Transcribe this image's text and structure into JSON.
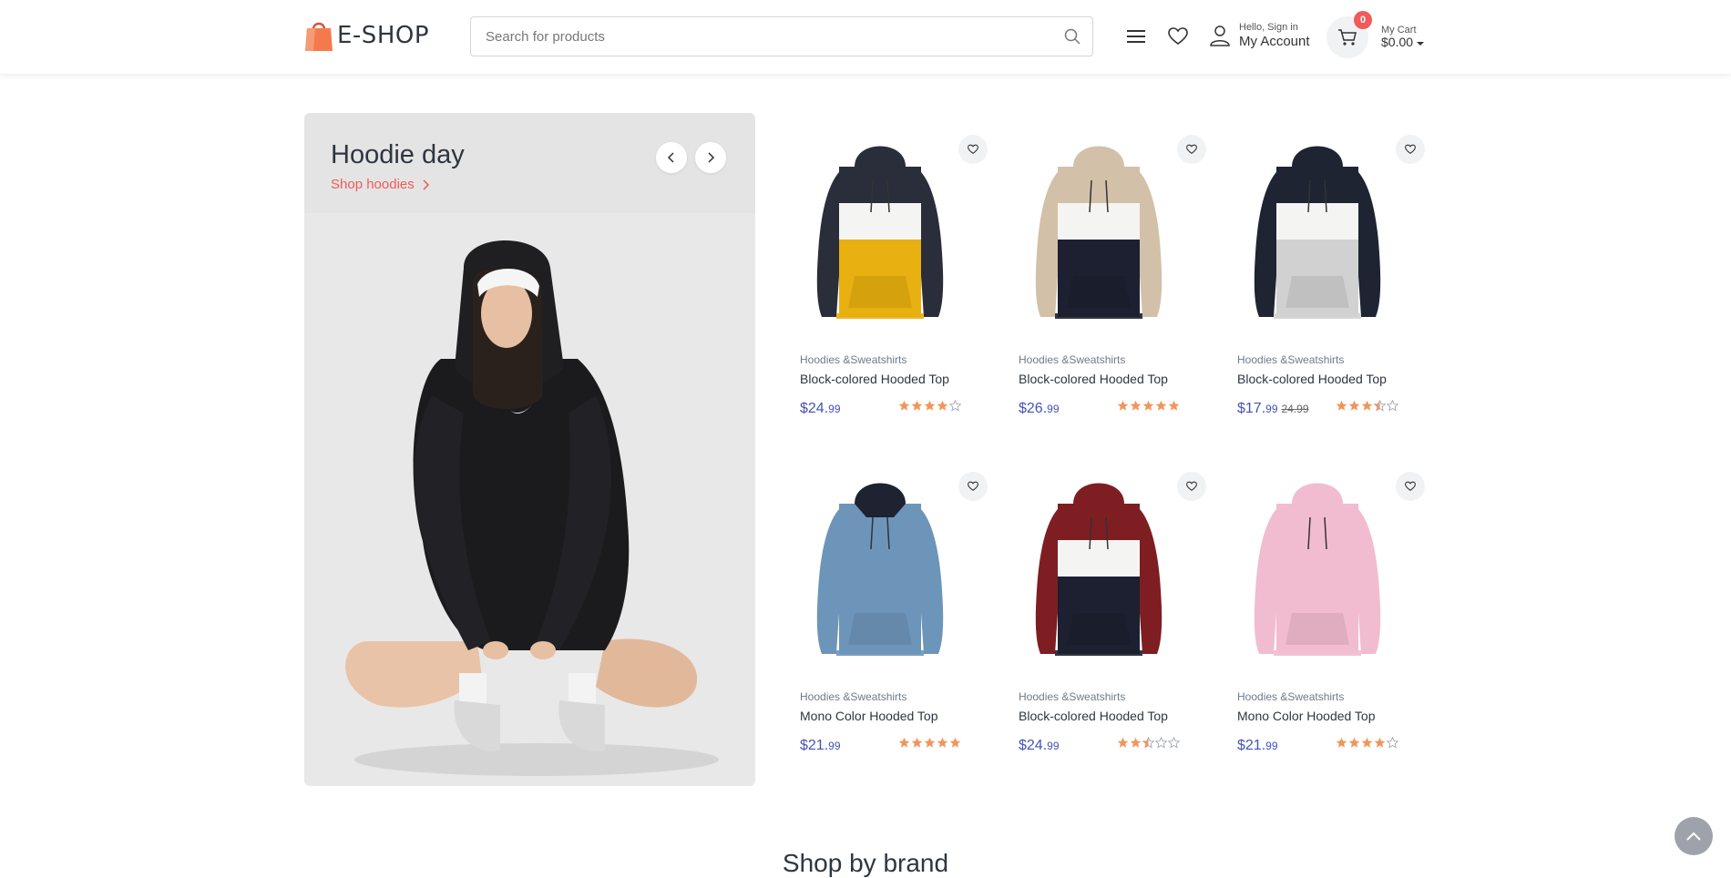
{
  "header": {
    "logo_text": "E-SHOP",
    "search_placeholder": "Search for products",
    "account_greeting": "Hello, Sign in",
    "account_label": "My Account",
    "cart_label": "My Cart",
    "cart_total": "$0.00",
    "cart_count": "0"
  },
  "banner": {
    "title": "Hoodie day",
    "link": "Shop hoodies"
  },
  "products": [
    {
      "category": "Hoodies &Sweatshirts",
      "name": "Block-colored Hooded Top",
      "price_main": "$24.",
      "price_cents": "99",
      "old_price": "",
      "rating": 4
    },
    {
      "category": "Hoodies &Sweatshirts",
      "name": "Block-colored Hooded Top",
      "price_main": "$26.",
      "price_cents": "99",
      "old_price": "",
      "rating": 5
    },
    {
      "category": "Hoodies &Sweatshirts",
      "name": "Block-colored Hooded Top",
      "price_main": "$17.",
      "price_cents": "99",
      "old_price": "24.99",
      "rating": 3.5
    },
    {
      "category": "Hoodies &Sweatshirts",
      "name": "Mono Color Hooded Top",
      "price_main": "$21.",
      "price_cents": "99",
      "old_price": "",
      "rating": 5
    },
    {
      "category": "Hoodies &Sweatshirts",
      "name": "Block-colored Hooded Top",
      "price_main": "$24.",
      "price_cents": "99",
      "old_price": "",
      "rating": 2.5
    },
    {
      "category": "Hoodies &Sweatshirts",
      "name": "Mono Color Hooded Top",
      "price_main": "$21.",
      "price_cents": "99",
      "old_price": "",
      "rating": 4
    }
  ],
  "section": {
    "brand_title": "Shop by brand"
  },
  "colors": {
    "accent": "#f05a5a",
    "price": "#4353b8",
    "star": "#f0965a",
    "star_empty": "#9aa0a8"
  },
  "icons": {
    "logo": "shopping-bag-icon",
    "search": "search-icon",
    "menu": "hamburger-icon",
    "wishlist": "heart-icon",
    "account": "user-icon",
    "cart": "cart-icon",
    "scroll_top": "chevron-up-icon"
  }
}
